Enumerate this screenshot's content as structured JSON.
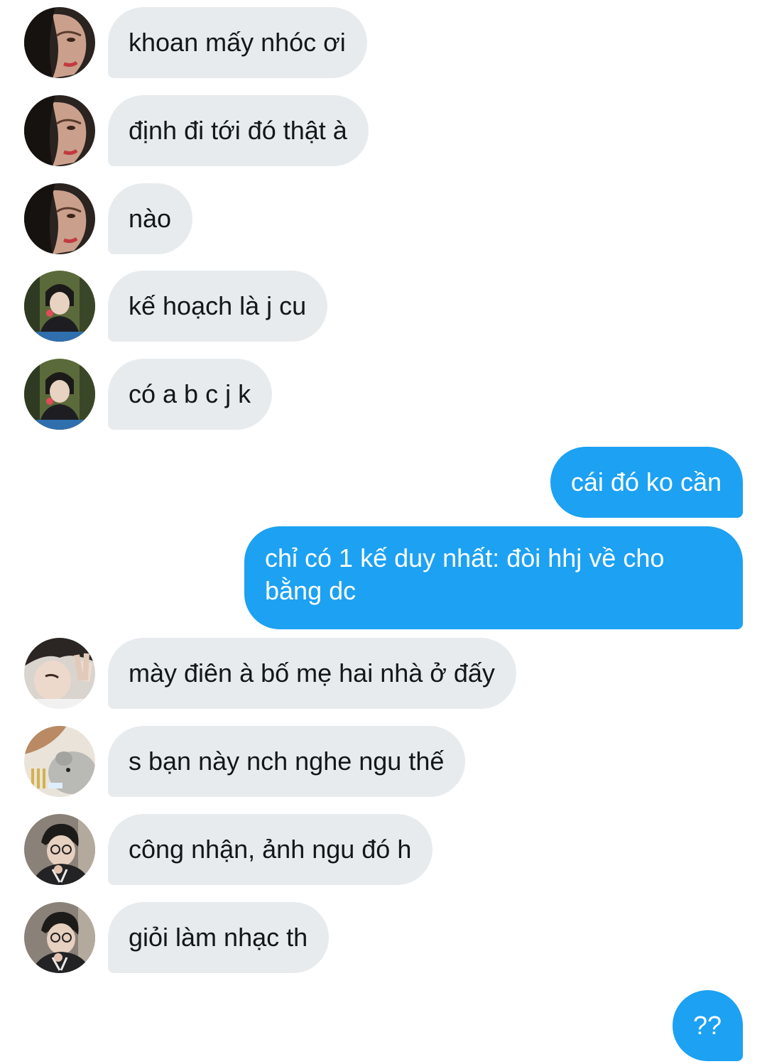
{
  "colors": {
    "incoming_bubble": "#e8ebee",
    "outgoing_bubble": "#1da1f2",
    "incoming_text": "#14171a",
    "outgoing_text": "#ffffff"
  },
  "messages": [
    {
      "direction": "incoming",
      "avatar": "avatar-hooded-user",
      "text": "khoan mấy nhóc ơi"
    },
    {
      "direction": "incoming",
      "avatar": "avatar-hooded-user",
      "text": "định đi tới đó thật à"
    },
    {
      "direction": "incoming",
      "avatar": "avatar-hooded-user",
      "text": "nào"
    },
    {
      "direction": "incoming",
      "avatar": "avatar-dark-jacket-user",
      "text": "kế hoạch là j cu"
    },
    {
      "direction": "incoming",
      "avatar": "avatar-dark-jacket-user",
      "text": "có a b c j k"
    },
    {
      "direction": "outgoing",
      "text": "cái đó ko cần"
    },
    {
      "direction": "outgoing",
      "text": "chỉ có 1 kế duy nhất: đòi hhj về cho bằng dc"
    },
    {
      "direction": "incoming",
      "avatar": "avatar-peace-sign-user",
      "text": "mày điên à bố mẹ hai nhà ở đấy"
    },
    {
      "direction": "incoming",
      "avatar": "avatar-plush-toy-user",
      "text": "s bạn này nch nghe ngu thế"
    },
    {
      "direction": "incoming",
      "avatar": "avatar-glasses-user",
      "text": "công nhận, ảnh ngu đó h"
    },
    {
      "direction": "incoming",
      "avatar": "avatar-glasses-user",
      "text": "giỏi làm nhạc th"
    },
    {
      "direction": "outgoing",
      "text": "??"
    }
  ]
}
